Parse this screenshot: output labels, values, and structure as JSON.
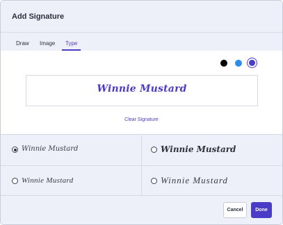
{
  "dialog": {
    "title": "Add Signature"
  },
  "tabs": [
    {
      "label": "Draw",
      "active": false
    },
    {
      "label": "Image",
      "active": false
    },
    {
      "label": "Type",
      "active": true
    }
  ],
  "colors": {
    "accent": "#4b3cc8",
    "swatches": [
      {
        "name": "black",
        "hex": "#000000",
        "selected": false
      },
      {
        "name": "blue",
        "hex": "#2b8fe8",
        "selected": false
      },
      {
        "name": "purple",
        "hex": "#4b3cc8",
        "selected": true
      }
    ]
  },
  "preview": {
    "text": "Winnie Mustard"
  },
  "clear_label": "Clear Signature",
  "options": [
    {
      "text": "Winnie Mustard",
      "selected": true
    },
    {
      "text": "Winnie Mustard",
      "selected": false
    },
    {
      "text": "Winnie Mustard",
      "selected": false
    },
    {
      "text": "Winnie Mustard",
      "selected": false
    }
  ],
  "buttons": {
    "cancel": "Cancel",
    "done": "Done"
  }
}
